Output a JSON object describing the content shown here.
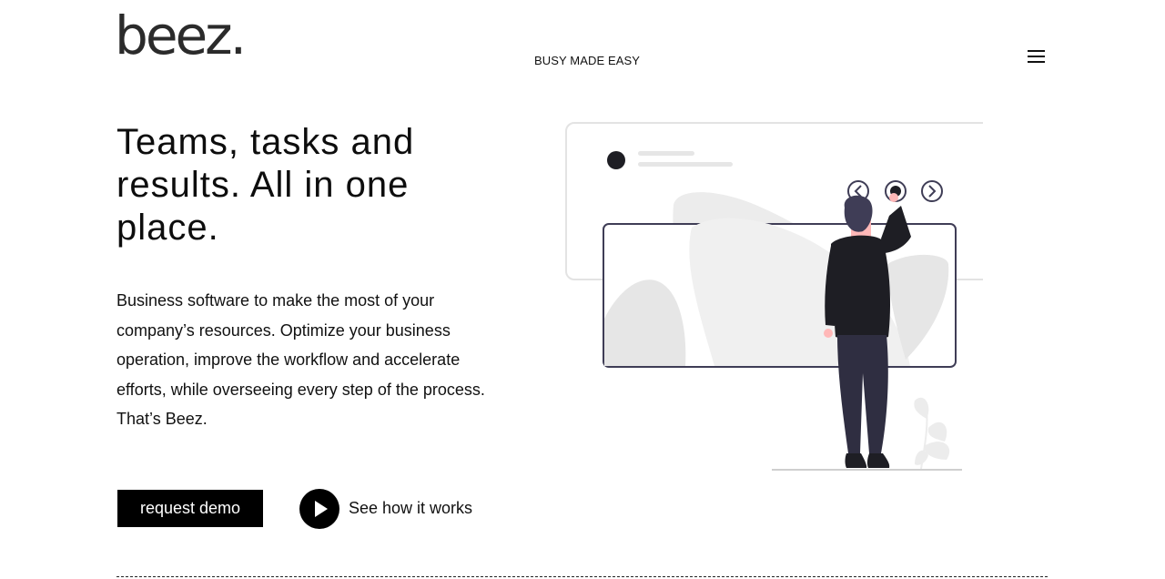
{
  "header": {
    "logo_text": "beez.",
    "tagline": "BUSY MADE EASY",
    "menu_icon": "hamburger-menu-icon"
  },
  "hero": {
    "headline": "Teams, tasks and results. All in one place.",
    "description": "Business software to make the most of your company’s resources. Optimize your business operation, improve the workflow and accelerate efforts, while overseeing every step of the process. That’s Beez.",
    "demo_button_label": "request demo",
    "how_link_label": "See how it works",
    "play_icon": "play-icon"
  },
  "illustration": {
    "icons": [
      "chevron-left-icon",
      "dot-icon",
      "chevron-right-icon"
    ]
  },
  "colors": {
    "text": "#111111",
    "button_bg": "#000000",
    "button_text": "#ffffff",
    "illustration_outline": "#3f3d56",
    "illustration_fill": "#e6e6e6",
    "accent_skin": "#ffb8b8"
  }
}
